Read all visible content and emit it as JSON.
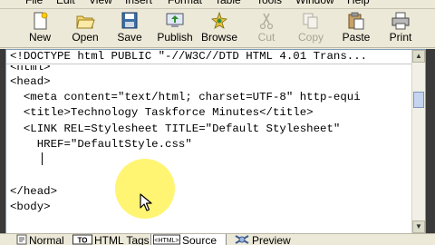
{
  "menu": {
    "items": [
      "File",
      "Edit",
      "View",
      "Insert",
      "Format",
      "Table",
      "Tools",
      "Window",
      "Help"
    ]
  },
  "toolbar": {
    "new_label": "New",
    "open_label": "Open",
    "save_label": "Save",
    "publish_label": "Publish",
    "browse_label": "Browse",
    "cut_label": "Cut",
    "copy_label": "Copy",
    "paste_label": "Paste",
    "print_label": "Print"
  },
  "editor": {
    "lines": [
      "<!DOCTYPE html PUBLIC \"-//W3C//DTD HTML 4.01 Trans...",
      "<html>",
      "<head>",
      "  <meta content=\"text/html; charset=UTF-8\" http-equi",
      "  <title>Technology Taskforce Minutes</title>",
      "  <LINK REL=Stylesheet TITLE=\"Default Stylesheet\"",
      "    HREF=\"DefaultStyle.css\"",
      "",
      "",
      "</head>",
      "<body>"
    ]
  },
  "tabs": {
    "normal": "Normal",
    "html_tags": "HTML Tags",
    "source": "Source",
    "preview": "Preview",
    "active": "Source"
  },
  "colors": {
    "chrome": "#ece9d8",
    "highlight": "#ffec00",
    "border": "#7f9db9"
  }
}
